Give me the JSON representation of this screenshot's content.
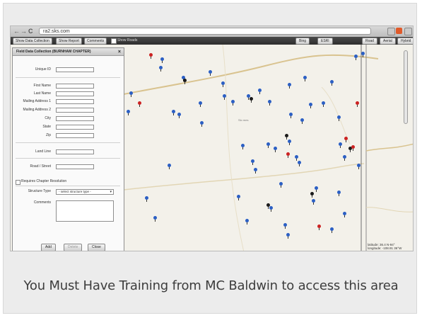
{
  "browser": {
    "url": "ra2.sks.com",
    "nav_back": "←",
    "nav_forward": "→",
    "nav_reload": "C"
  },
  "toolbar": {
    "show_data_collection": "Show Data Collection",
    "show_report": "Show Report",
    "comments": "Comments",
    "show_roads": "Show Roads",
    "bing": "Bing",
    "esri": "ESRI",
    "road": "Road",
    "aerial": "Aerial",
    "hybrid": "Hybrid"
  },
  "panel": {
    "title": "Field Data Collection  (BURNHAM CHAPTER)",
    "close": "×",
    "fields": {
      "unique_id": "Unique ID",
      "first_name": "First Name",
      "last_name": "Last Name",
      "mailing_address_1": "Mailing Address 1",
      "mailing_address_2": "Mailing Address 2",
      "city": "City",
      "state": "State",
      "zip": "Zip",
      "land_line": "Land Line",
      "road_street": "Road / Street",
      "structure_type": "Structure Type",
      "comments": "Comments"
    },
    "requires_chapter_resolution": "Requires Chapter Resolution",
    "structure_select": "- select structure type -",
    "add": "Add",
    "delete": "Delete",
    "close_button": "Close"
  },
  "map": {
    "scale_text": "latitude: 36.4 N-94°\nlongitude: -108.91 36°W",
    "label_1": "Slo mes"
  },
  "caption": "You Must Have Training from MC Baldwin to access this area",
  "colors": {
    "pin_blue": "#2b5fc4",
    "pin_red": "#cc2222",
    "pin_black": "#1a1a1a",
    "caption_text": "#3d3d3d"
  },
  "icons": [
    "back-arrow-icon",
    "forward-arrow-icon",
    "reload-icon",
    "close-icon",
    "map-pin-icon",
    "zoom-slider-icon"
  ]
}
